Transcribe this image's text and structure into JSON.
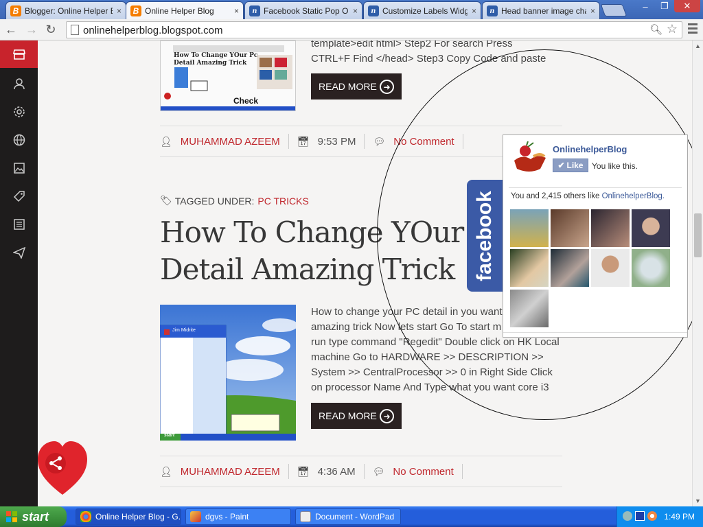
{
  "browser": {
    "tabs": [
      {
        "label": "Blogger: Online Helper Bl",
        "icon": "blogger-icon",
        "active": false
      },
      {
        "label": "Online Helper Blog",
        "icon": "blogger-icon",
        "active": true
      },
      {
        "label": "Facebook Static Pop Out",
        "icon": "n-logo-icon",
        "active": false
      },
      {
        "label": "Customize Labels Widget",
        "icon": "n-logo-icon",
        "active": false
      },
      {
        "label": "Head banner image chan",
        "icon": "n-logo-icon",
        "active": false
      }
    ],
    "tab_close": "×",
    "url": "onlinehelperblog.blogspot.com"
  },
  "sidebar": {
    "icons": [
      "store-icon",
      "user-icon",
      "gear-icon",
      "globe-icon",
      "image-icon",
      "tag-icon",
      "newspaper-icon",
      "send-icon"
    ]
  },
  "posts": [
    {
      "snippet_lines": [
        "template>edit html> Step2    For search     Press",
        "CTRL+F    Find </head>    Step3   Copy Code and paste"
      ],
      "read_more": "READ MORE",
      "author": "MUHAMMAD AZEEM",
      "time": "9:53 PM",
      "comments": "No Comment",
      "thumb_caption": "Check",
      "thumb_title": "How To Change YOur Pc Detail Amazing Trick"
    },
    {
      "tag_prefix": "TAGGED UNDER:",
      "tag": "PC TRICKS",
      "title_lines": [
        "How To Change YOur P",
        "Detail Amazing Trick"
      ],
      "snippet_lines": [
        "How to change your PC detail in you want  t",
        "amazing trick Now lets start Go To start m",
        "run  type command \"Regedit\" Double click on HK Local",
        "machine Go to HARDWARE >> DESCRIPTION >>",
        "System >>  CentralProcessor >> 0  in Right Side Click",
        "on processor Name  And Type what you want core i3"
      ],
      "read_more": "READ MORE",
      "author": "MUHAMMAD AZEEM",
      "time": "4:36 AM",
      "comments": "No Comment",
      "thumb_user": "Jim Midrite",
      "thumb_start": "start"
    }
  ],
  "facebook_popup": {
    "tab_label": "facebook",
    "page_name": "OnlinehelperBlog",
    "like_button": "Like",
    "you_like": "You like this.",
    "others_text": "You and 2,415 others like",
    "others_link": "OnlinehelperBlog.",
    "faces": 9
  },
  "taskbar": {
    "start": "start",
    "tasks": [
      {
        "label": "Online Helper Blog - G...",
        "active": true
      },
      {
        "label": "dgvs - Paint",
        "active": false
      },
      {
        "label": "Document - WordPad",
        "active": false
      }
    ],
    "clock": "1:49 PM"
  }
}
